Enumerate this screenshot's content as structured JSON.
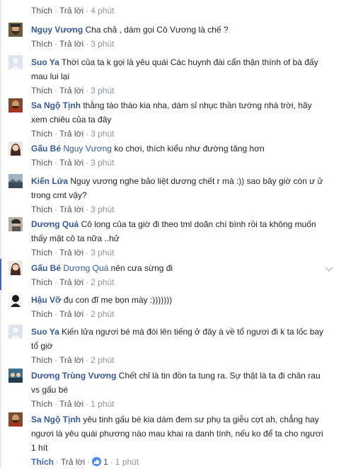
{
  "actions": {
    "like": "Thích",
    "reply": "Trả lời",
    "separator": "·"
  },
  "top_meta": {
    "time": "4 phút"
  },
  "comments": [
    {
      "name": "Ngụy Vương",
      "tag": "",
      "text": "Cha chả , dám gọi Cô Vương là chế ?",
      "time": "3 phút",
      "avatar": "bearded-man"
    },
    {
      "name": "Suo Ya",
      "tag": "",
      "text": "Thời của ta k gọi là yêu quái Các huynh đài cẩn thận thính of bà đấy mau lui lại",
      "time": "3 phút",
      "avatar": "blank"
    },
    {
      "name": "Sa Ngộ Tịnh",
      "tag": "",
      "text": "thằng tào tháo kia nha, dám sỉ nhục thần tướng nhà trời, hãy xem chiêu của ta đây",
      "time": "3 phút",
      "avatar": "bearded-monk"
    },
    {
      "name": "Gấu Bé",
      "tag": "Nguy Vương",
      "text": "ko chơi, thích kiểu như đường tăng hơn",
      "time": "3 phút",
      "avatar": "girl"
    },
    {
      "name": "Kiến Lửa",
      "tag": "",
      "text": "Nguy vương nghe bảo liệt dương chết r mà :)) sao bây giờ còn ư ử trong cmt vậy?",
      "time": "3 phút",
      "avatar": "landscape"
    },
    {
      "name": "Dương Quá",
      "tag": "",
      "text": "Cô long của ta giờ đi theo tml doãn chí bình rồi ta không muốn thấy mặt cô ta nữa ..hử",
      "time": "3 phút",
      "avatar": "swordsman"
    },
    {
      "name": "Gấu Bé",
      "tag": "Dương Quá",
      "text": "nên cưa sừng đi",
      "time": "2 phút",
      "avatar": "girl"
    },
    {
      "name": "Hậu Vỡ",
      "tag": "",
      "text": "đụ con đĩ mẹ bọn mày :)))))))",
      "time": "2 phút",
      "avatar": "dark-figure"
    },
    {
      "name": "Suo Ya",
      "tag": "",
      "text": "Kiến lửa ngươi bé mà đòi lên tiếng ở đây à về tổ ngươi đi k ta lốc bay tổ giờ",
      "time": "2 phút",
      "avatar": "blank"
    },
    {
      "name": "Dương Trùng Vương",
      "tag": "",
      "text": "Chết chỉ là tin đồn ta tung ra. Sự thật là ta đi chăn rau vs gấu bé",
      "time": "1 phút",
      "avatar": "group"
    },
    {
      "name": "Sa Ngộ Tịnh",
      "tag": "",
      "text": "yêu tinh gấu bé kia dám đem sư phụ ta giễu cợt ah, chẳng hay ngươi là yêu quái phương nào mau khai ra danh tính, nếu ko để ta cho ngươi 1 hít",
      "time": "1 phút",
      "avatar": "bearded-monk",
      "likes": "1",
      "liked": true
    }
  ],
  "colors": {
    "link": "#365899",
    "meta": "#90949c",
    "action": "#4b4f56",
    "like_active": "#4267b2",
    "like_badge": "#4f88f7"
  }
}
